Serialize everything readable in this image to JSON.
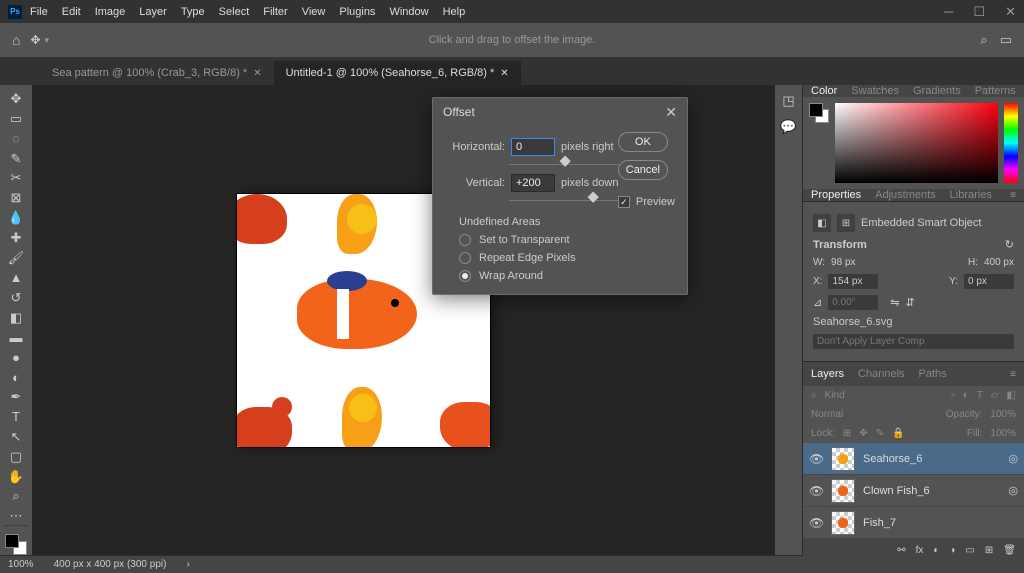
{
  "menu": [
    "File",
    "Edit",
    "Image",
    "Layer",
    "Type",
    "Select",
    "Filter",
    "View",
    "Plugins",
    "Window",
    "Help"
  ],
  "options_hint": "Click and drag to offset the image.",
  "tabs": [
    {
      "label": "Sea pattern @ 100% (Crab_3, RGB/8) *",
      "active": false
    },
    {
      "label": "Untitled-1 @ 100% (Seahorse_6, RGB/8) *",
      "active": true
    }
  ],
  "dialog": {
    "title": "Offset",
    "horizontal_label": "Horizontal:",
    "horizontal_value": "0",
    "horizontal_unit": "pixels right",
    "vertical_label": "Vertical:",
    "vertical_value": "+200",
    "vertical_unit": "pixels down",
    "ok": "OK",
    "cancel": "Cancel",
    "preview": "Preview",
    "undefined_areas": "Undefined Areas",
    "opt_transparent": "Set to Transparent",
    "opt_repeat": "Repeat Edge Pixels",
    "opt_wrap": "Wrap Around"
  },
  "panels": {
    "color_tabs": [
      "Color",
      "Swatches",
      "Gradients",
      "Patterns"
    ],
    "props_tabs": [
      "Properties",
      "Adjustments",
      "Libraries"
    ],
    "embedded": "Embedded Smart Object",
    "transform": "Transform",
    "w_label": "W:",
    "w_val": "98 px",
    "h_label": "H:",
    "h_val": "400 px",
    "x_label": "X:",
    "x_val": "154 px",
    "y_label": "Y:",
    "y_val": "0 px",
    "angle_val": "0.00°",
    "filename": "Seahorse_6.svg",
    "layercomp": "Don't Apply Layer Comp",
    "layer_tabs": [
      "Layers",
      "Channels",
      "Paths"
    ],
    "kind_label": "Kind",
    "blend": "Normal",
    "opacity_label": "Opacity:",
    "opacity_val": "100%",
    "lock_label": "Lock:",
    "fill_label": "Fill:",
    "fill_val": "100%",
    "layers": [
      {
        "name": "Seahorse_6",
        "selected": true,
        "smart": true
      },
      {
        "name": "Clown Fish_6",
        "selected": false,
        "smart": true
      },
      {
        "name": "Fish_7",
        "selected": false,
        "smart": false
      }
    ]
  },
  "status": {
    "zoom": "100%",
    "doc": "400 px x 400 px (300 ppi)"
  }
}
